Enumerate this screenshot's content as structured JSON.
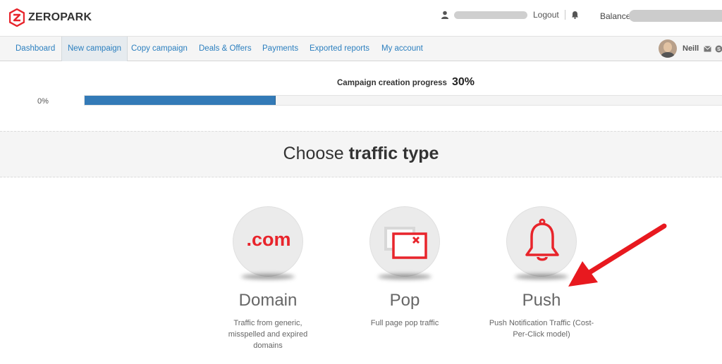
{
  "header": {
    "logo_text": "ZEROPARK",
    "logout": "Logout",
    "balance_label": "Balance:"
  },
  "nav": {
    "items": [
      {
        "label": "Dashboard"
      },
      {
        "label": "New campaign",
        "active": true
      },
      {
        "label": "Copy campaign"
      },
      {
        "label": "Deals & Offers"
      },
      {
        "label": "Payments"
      },
      {
        "label": "Exported reports"
      },
      {
        "label": "My account"
      }
    ],
    "profile_name": "Neill"
  },
  "progress": {
    "caption": "Campaign creation progress",
    "percent_label": "30%",
    "value": 0.3,
    "start_label": "0%"
  },
  "heading": {
    "light": "Choose",
    "bold": "traffic type"
  },
  "cards": [
    {
      "title": "Domain",
      "icon_text": ".com",
      "icon": "dotcom-icon",
      "description": "Traffic from generic, misspelled and expired domains"
    },
    {
      "title": "Pop",
      "icon": "popup-window-icon",
      "description": "Full page pop traffic"
    },
    {
      "title": "Push",
      "icon": "bell-icon",
      "description": "Push Notification Traffic (Cost-Per-Click model)"
    }
  ],
  "colors": {
    "accent_blue": "#337ab7",
    "link_blue": "#2b7fbf",
    "brand_red": "#e8242b",
    "annotation_arrow": "#e8191f"
  }
}
